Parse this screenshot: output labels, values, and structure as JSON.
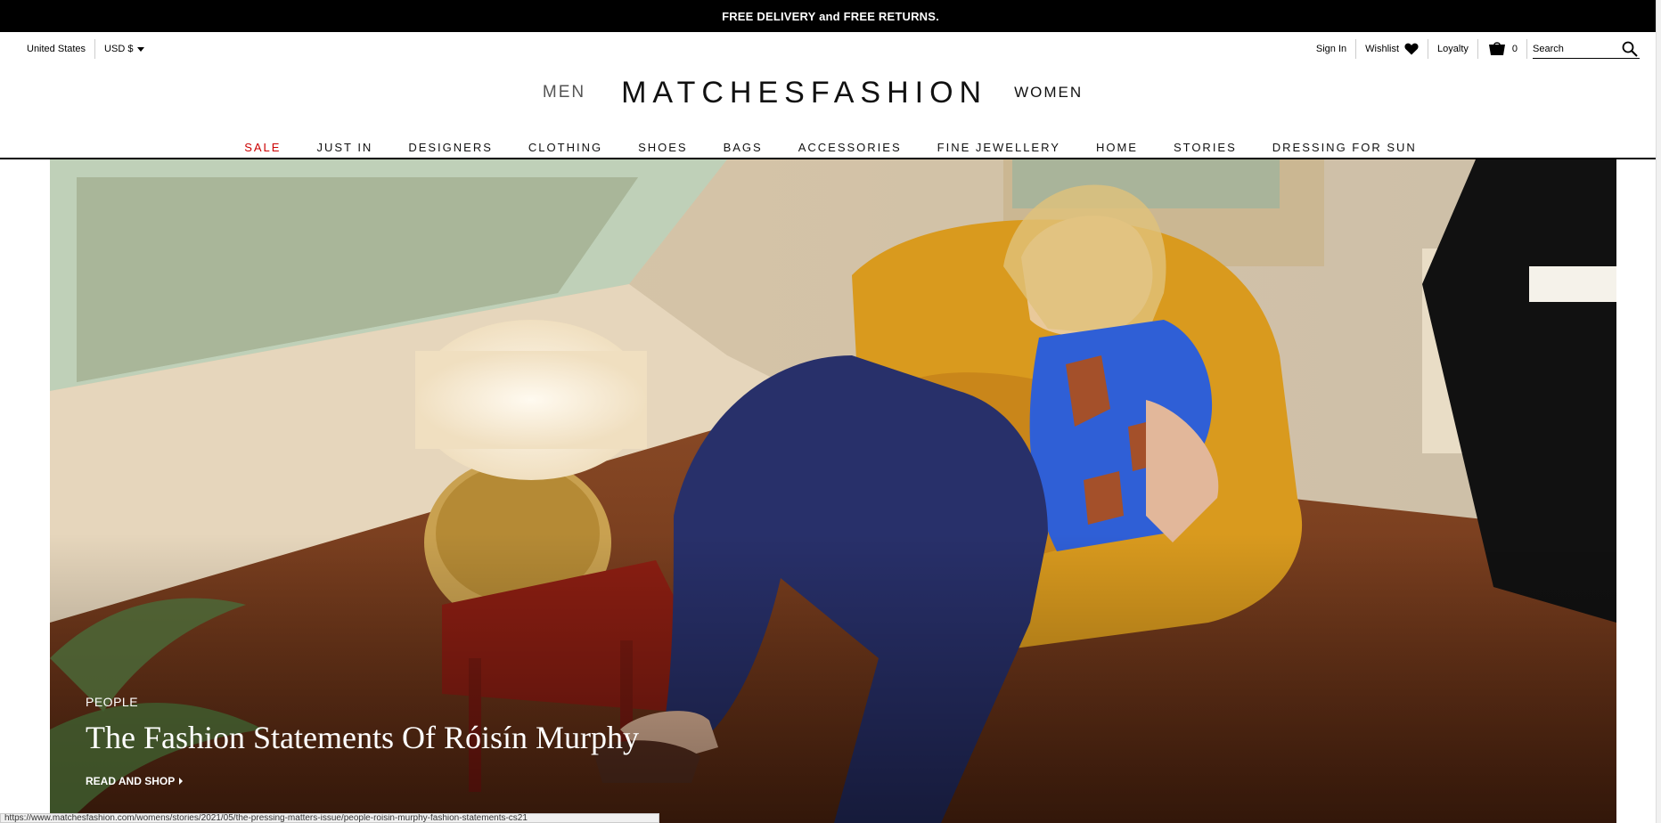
{
  "promo": {
    "text": "FREE DELIVERY and FREE RETURNS."
  },
  "utility": {
    "country": "United States",
    "currency": "USD $",
    "sign_in": "Sign In",
    "wishlist": "Wishlist",
    "loyalty": "Loyalty",
    "bag_count": "0",
    "search_placeholder": "Search"
  },
  "brand": {
    "men": "MEN",
    "logo": "MATCHESFASHION",
    "women": "WOMEN"
  },
  "nav": {
    "items": [
      "SALE",
      "JUST IN",
      "DESIGNERS",
      "CLOTHING",
      "SHOES",
      "BAGS",
      "ACCESSORIES",
      "FINE JEWELLERY",
      "HOME",
      "STORIES",
      "DRESSING FOR SUN"
    ]
  },
  "hero": {
    "category": "PEOPLE",
    "title": "The Fashion Statements Of Róisín Murphy",
    "cta": "READ AND SHOP"
  },
  "status_bar": {
    "url": "https://www.matchesfashion.com/womens/stories/2021/05/the-pressing-matters-issue/people-roisin-murphy-fashion-statements-cs21"
  },
  "colors": {
    "sale": "#cc0000",
    "promo_bg": "#000000",
    "chair": "#d99a1e",
    "wall": "#e8d9c0",
    "floor": "#7a3b1c"
  },
  "icons": {
    "wishlist": "heart-icon",
    "bag": "bag-icon",
    "search": "search-icon",
    "currency": "caret-down-icon",
    "cta": "triangle-right-icon"
  }
}
